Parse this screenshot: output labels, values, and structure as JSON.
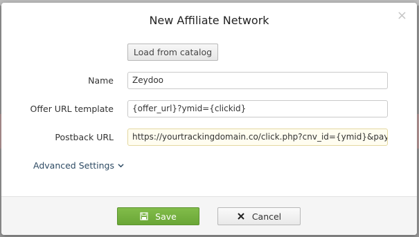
{
  "dialog": {
    "title": "New Affiliate Network",
    "close_icon": "close-icon"
  },
  "catalog_button": {
    "label": "Load from catalog"
  },
  "form": {
    "name": {
      "label": "Name",
      "value": "Zeydoo"
    },
    "offer_url_template": {
      "label": "Offer URL template",
      "value": "{offer_url}?ymid={clickid}"
    },
    "postback_url": {
      "label": "Postback URL",
      "value": "https://yourtrackingdomain.co/click.php?cnv_id={ymid}&payout={payout}"
    }
  },
  "advanced_settings": {
    "label": "Advanced Settings",
    "icon": "chevron-down-icon"
  },
  "footer": {
    "save": {
      "label": "Save",
      "icon": "floppy-disk-icon"
    },
    "cancel": {
      "label": "Cancel",
      "icon": "x-icon"
    }
  },
  "colors": {
    "save_green": "#6aa636",
    "link_blue": "#2d4a63",
    "focused_field_bg": "#fffdf0"
  }
}
